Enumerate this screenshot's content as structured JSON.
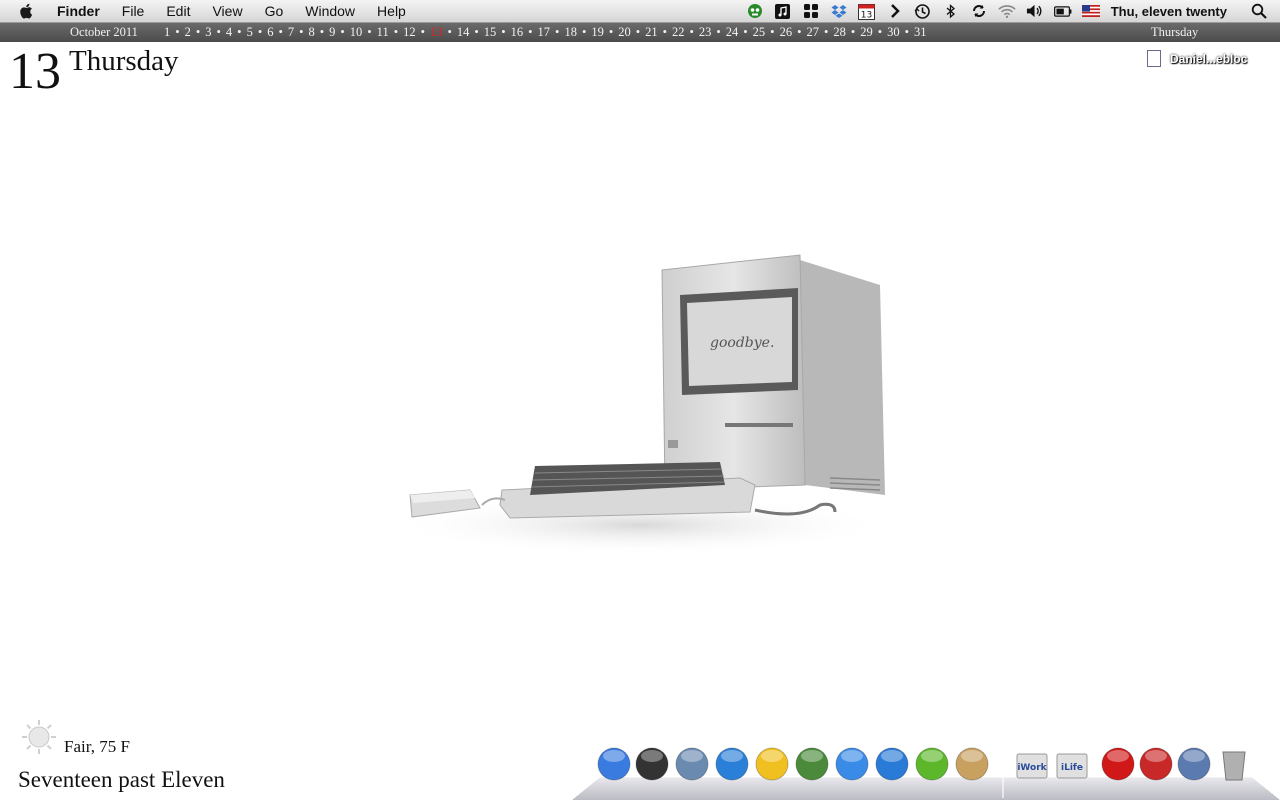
{
  "menubar": {
    "app_name": "Finder",
    "items": [
      "File",
      "Edit",
      "View",
      "Go",
      "Window",
      "Help"
    ],
    "clock": "Thu, eleven twenty",
    "status_icons": [
      "growl-icon",
      "music-icon",
      "spaces-icon",
      "dropbox-icon",
      "ical-icon",
      "chevron-icon",
      "time-machine-icon",
      "bluetooth-icon",
      "sync-icon",
      "wifi-icon",
      "volume-icon",
      "battery-icon",
      "us-flag-icon",
      "spotlight-icon"
    ],
    "ical_day": "13"
  },
  "calendar": {
    "month_year": "October 2011",
    "days": [
      "1",
      "2",
      "3",
      "4",
      "5",
      "6",
      "7",
      "8",
      "9",
      "10",
      "11",
      "12",
      "13",
      "14",
      "15",
      "16",
      "17",
      "18",
      "19",
      "20",
      "21",
      "22",
      "23",
      "24",
      "25",
      "26",
      "27",
      "28",
      "29",
      "30",
      "31"
    ],
    "today": "13",
    "weekday": "Thursday",
    "today_color": "#e62020"
  },
  "date_widget": {
    "day_number": "13",
    "day_name": "Thursday"
  },
  "desktop": {
    "file_label": "Daniel...ebloc",
    "mac_screen_text": "goodbye."
  },
  "weather": {
    "summary": "Fair, 75 F",
    "icon": "sun-icon"
  },
  "time_in_words": "Seventeen past Eleven",
  "dock": {
    "items": [
      {
        "name": "finder",
        "icon": "finder-icon",
        "color": "#3a7be0"
      },
      {
        "name": "dashboard",
        "icon": "dashboard-icon",
        "color": "#333333"
      },
      {
        "name": "mail",
        "icon": "mail-icon",
        "color": "#6a8ab0"
      },
      {
        "name": "app-store",
        "icon": "app-store-icon",
        "color": "#2a7fd8"
      },
      {
        "name": "chrome",
        "icon": "chrome-icon",
        "color": "#f0c020"
      },
      {
        "name": "adium",
        "icon": "adium-icon",
        "color": "#4a8a3a"
      },
      {
        "name": "ichat",
        "icon": "ichat-icon",
        "color": "#3a8ae8"
      },
      {
        "name": "itunes",
        "icon": "itunes-icon",
        "color": "#2a7ad8"
      },
      {
        "name": "spotify",
        "icon": "spotify-icon",
        "color": "#5cb82a"
      },
      {
        "name": "address-book",
        "icon": "address-book-icon",
        "color": "#c8a060"
      },
      {
        "name": "iwork-folder",
        "icon": "iwork-folder-icon",
        "color": "#e0e0e0",
        "label": "iWork"
      },
      {
        "name": "ilife-folder",
        "icon": "ilife-folder-icon",
        "color": "#e0e0e0",
        "label": "iLife"
      },
      {
        "name": "red-dice-app",
        "icon": "dice-app-icon",
        "color": "#d01818"
      },
      {
        "name": "red-orb-app",
        "icon": "orb-app-icon",
        "color": "#c82828"
      },
      {
        "name": "blue-orb-app",
        "icon": "sphere-app-icon",
        "color": "#5a7ab0"
      },
      {
        "name": "trash",
        "icon": "trash-icon",
        "color": "#b0b0b0"
      }
    ]
  }
}
